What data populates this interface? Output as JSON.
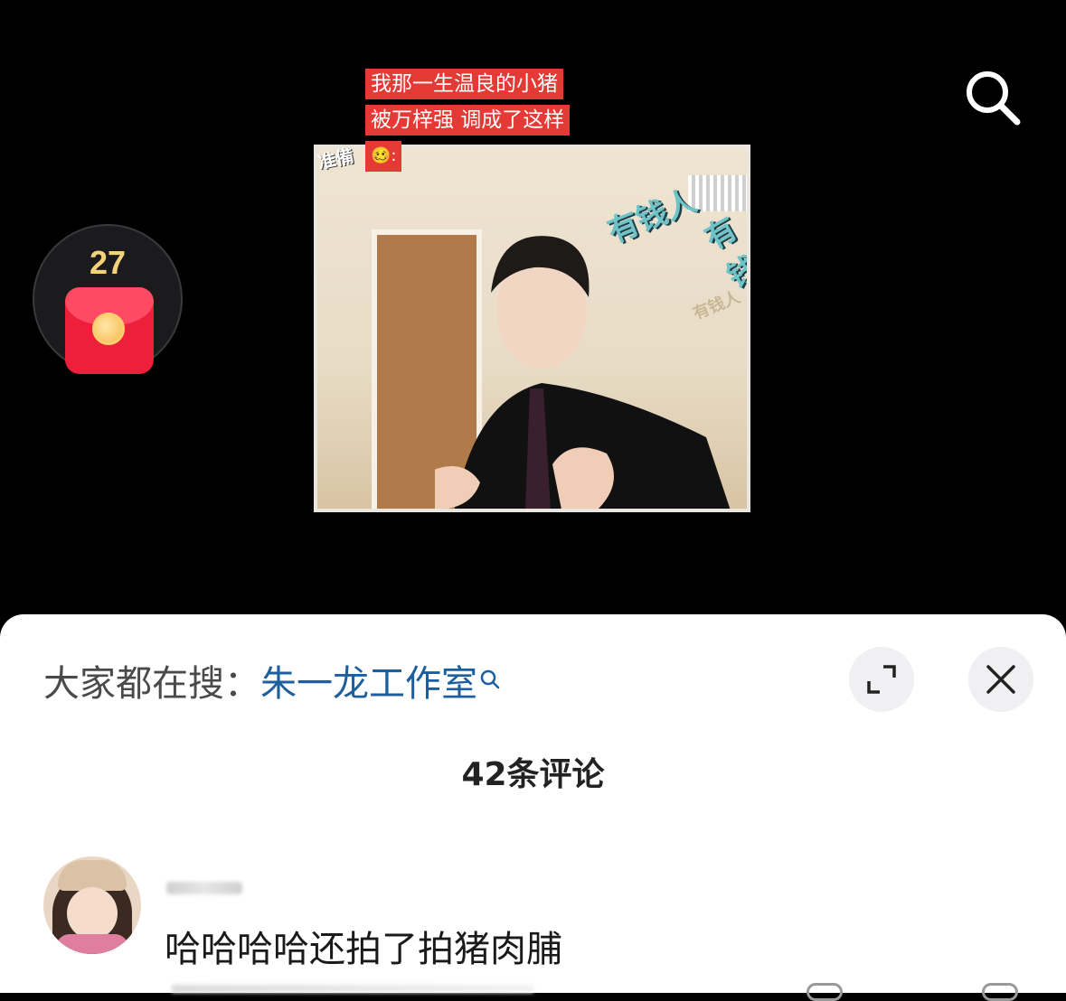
{
  "video": {
    "caption_lines": [
      "我那一生温良的小猪",
      "被万梓强 调成了这样",
      "🥴:"
    ],
    "stickers": [
      "有钱人",
      "有钱",
      "有钱人"
    ],
    "watermark": "准備"
  },
  "red_packet": {
    "count": "27",
    "icon": "red-envelope-icon"
  },
  "top_bar": {
    "search_icon": "search-icon"
  },
  "sheet": {
    "hot_search_prefix": "大家都在搜：",
    "hot_search_keyword": "朱一龙工作室",
    "expand_icon": "expand-icon",
    "close_icon": "close-icon",
    "comment_count": "42条评论"
  },
  "comments": [
    {
      "text": "哈哈哈哈还拍了拍猪肉脯"
    }
  ],
  "colors": {
    "accent_link": "#1d5f9e",
    "caption_bg": "#e53935",
    "packet_red": "#ee1f3b"
  }
}
